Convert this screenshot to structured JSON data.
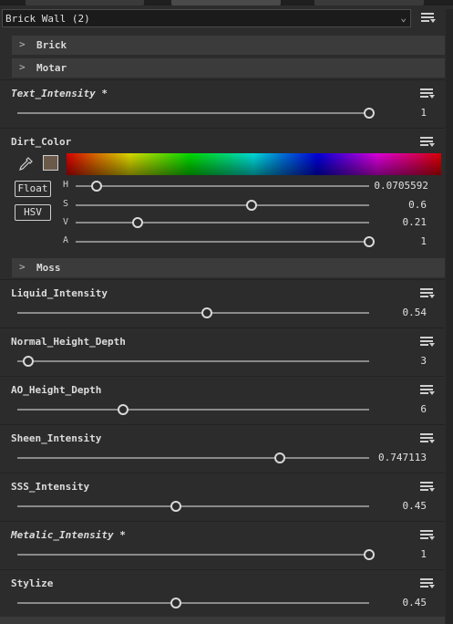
{
  "material_select": {
    "value": "Brick Wall (2)"
  },
  "groups": [
    {
      "label": "Brick"
    },
    {
      "label": "Motar"
    },
    {
      "label": "Moss"
    }
  ],
  "text_intensity": {
    "label": "Text_Intensity *",
    "value": "1",
    "fraction": 1.0
  },
  "dirt_color": {
    "label": "Dirt_Color",
    "swatch": "#6b5a4a",
    "float_label": "Float",
    "hsv_label": "HSV",
    "channels": [
      {
        "name": "H",
        "value": "0.0705592",
        "fraction": 0.0705592
      },
      {
        "name": "S",
        "value": "0.6",
        "fraction": 0.6
      },
      {
        "name": "V",
        "value": "0.21",
        "fraction": 0.21
      },
      {
        "name": "A",
        "value": "1",
        "fraction": 1.0
      }
    ]
  },
  "params": [
    {
      "label": "Liquid_Intensity",
      "value": "0.54",
      "fraction": 0.54,
      "italic": false
    },
    {
      "label": "Normal_Height_Depth",
      "value": "3",
      "fraction": 0.03,
      "italic": false
    },
    {
      "label": "AO_Height_Depth",
      "value": "6",
      "fraction": 0.3,
      "italic": false
    },
    {
      "label": "Sheen_Intensity",
      "value": "0.747113",
      "fraction": 0.747113,
      "italic": false
    },
    {
      "label": "SSS_Intensity",
      "value": "0.45",
      "fraction": 0.45,
      "italic": false
    },
    {
      "label": "Metalic_Intensity *",
      "value": "1",
      "fraction": 1.0,
      "italic": true
    },
    {
      "label": "Stylize",
      "value": "0.45",
      "fraction": 0.45,
      "italic": false
    }
  ]
}
